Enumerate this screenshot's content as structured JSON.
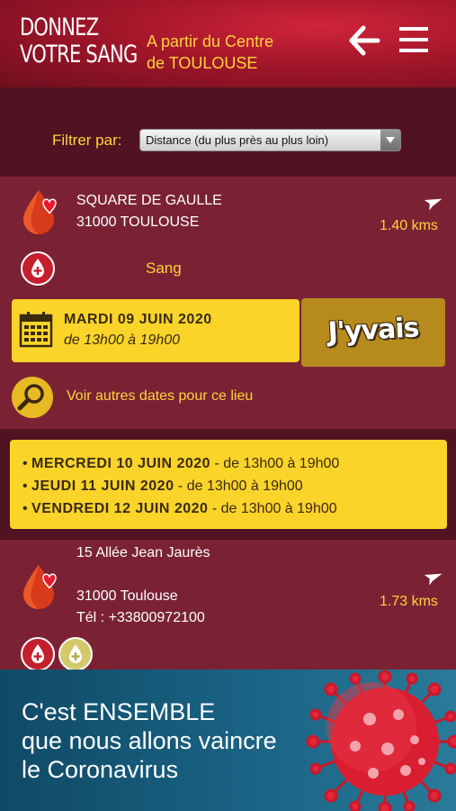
{
  "header": {
    "logo_line1": "DONNEZ",
    "logo_line2": "VOTRE SANG",
    "subtitle_line1": "A partir du Centre",
    "subtitle_line2": "de TOULOUSE",
    "back_icon": "arrow-left-icon",
    "menu_icon": "hamburger-menu-icon"
  },
  "filter": {
    "label": "Filtrer par:",
    "selected": "Distance (du plus près au plus loin)"
  },
  "entries": [
    {
      "address_line1": "SQUARE DE GAULLE",
      "address_line2": "31000 TOULOUSE",
      "distance": "1.40 kms",
      "donation_type": "Sang",
      "next_date": "MARDI 09 JUIN 2020",
      "next_hours": "de 13h00 à 19h00",
      "cta": "J'yvais",
      "other_dates_label": "Voir autres dates pour ce lieu",
      "other_dates": [
        {
          "date": "MERCREDI 10 JUIN 2020",
          "hours": " - de 13h00 à 19h00"
        },
        {
          "date": "JEUDI 11 JUIN 2020",
          "hours": " - de 13h00 à 19h00"
        },
        {
          "date": "VENDREDI 12 JUIN 2020",
          "hours": " - de 13h00 à 19h00"
        }
      ]
    },
    {
      "address_line1": "15 Allée Jean Jaurès",
      "address_line2": "31000 Toulouse",
      "phone": "Tél : +33800972100",
      "distance": "1.73 kms"
    }
  ],
  "banner": {
    "line1": "C'est ENSEMBLE",
    "line2": "que nous allons vaincre",
    "line3": "le Coronavirus"
  },
  "colors": {
    "accent_yellow": "#fbd42a",
    "label_yellow": "#ffd33d",
    "row_bg": "#7a2234",
    "band_bg": "#501321",
    "banner_bg": "#1a6384"
  }
}
